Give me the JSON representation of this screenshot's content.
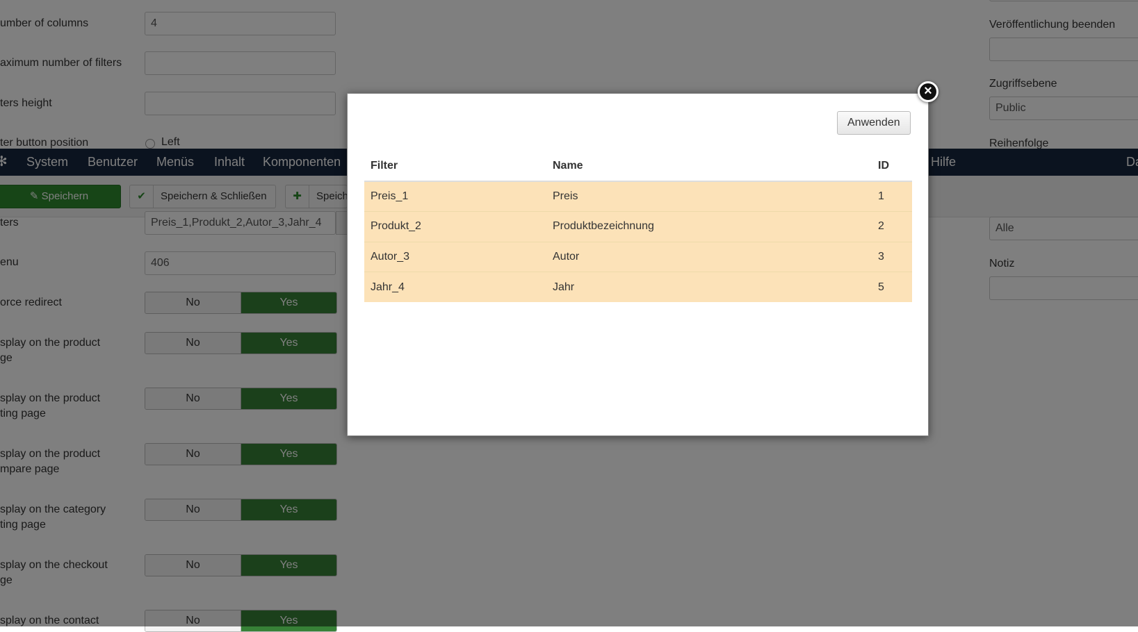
{
  "form": {
    "fields": [
      {
        "label": "umber of columns",
        "value": "4"
      },
      {
        "label": "aximum number of filters",
        "value": ""
      },
      {
        "label": "ters height",
        "value": ""
      },
      {
        "label": "ter button position",
        "radio": "Left"
      }
    ],
    "filters_label": "ters",
    "filters_value": "Preis_1,Produkt_2,Autor_3,Jahr_4",
    "menu_label": "enu",
    "menu_value": "406",
    "toggles": [
      {
        "label": "orce redirect",
        "no": "No",
        "yes": "Yes"
      },
      {
        "label": "splay on the product\nge",
        "no": "No",
        "yes": "Yes"
      },
      {
        "label": "splay on the product\nting page",
        "no": "No",
        "yes": "Yes"
      },
      {
        "label": "splay on the product\nmpare page",
        "no": "No",
        "yes": "Yes"
      },
      {
        "label": "splay on the category\nting page",
        "no": "No",
        "yes": "Yes"
      },
      {
        "label": "splay on the checkout\nge",
        "no": "No",
        "yes": "Yes"
      },
      {
        "label": "splay on the contact",
        "no": "No",
        "yes": "Yes"
      }
    ]
  },
  "right": {
    "end_publish_label": "Veröffentlichung beenden",
    "access_label": "Zugriffsebene",
    "access_value": "Public",
    "order_label": "Reihenfolge",
    "language_value": "Alle",
    "note_label": "Notiz"
  },
  "navbar": {
    "items": [
      "System",
      "Benutzer",
      "Menüs",
      "Inhalt",
      "Komponenten"
    ],
    "help": "Hilfe",
    "right_partial": "Da"
  },
  "toolbar": {
    "save": "Speichern",
    "save_close": "Speichern & Schließen",
    "save_new_partial": "Speich"
  },
  "modal": {
    "apply": "Anwenden",
    "columns": [
      "Filter",
      "Name",
      "ID"
    ],
    "rows": [
      {
        "filter": "Preis_1",
        "name": "Preis",
        "id": "1"
      },
      {
        "filter": "Produkt_2",
        "name": "Produktbezeichnung",
        "id": "2"
      },
      {
        "filter": "Autor_3",
        "name": "Autor",
        "id": "3"
      },
      {
        "filter": "Jahr_4",
        "name": "Jahr",
        "id": "5"
      }
    ]
  }
}
